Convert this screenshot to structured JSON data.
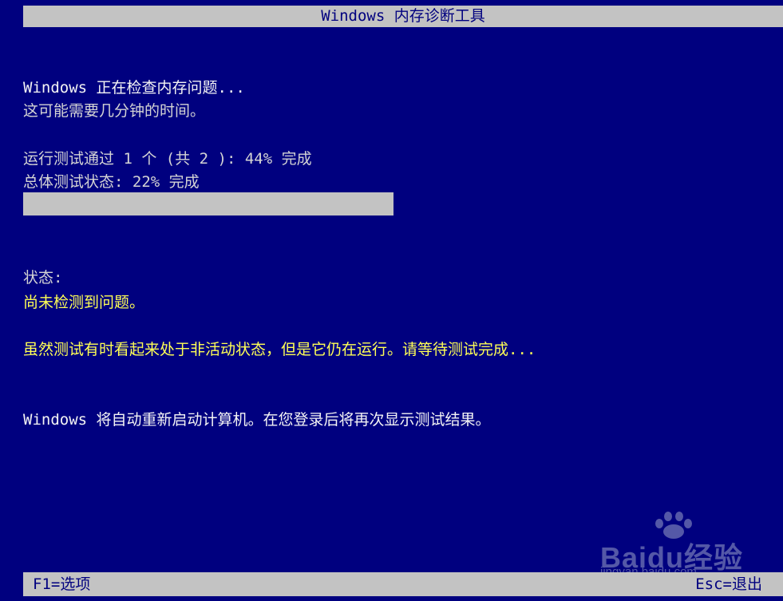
{
  "window": {
    "title": "Windows 内存诊断工具"
  },
  "main": {
    "checking_line": "Windows 正在检查内存问题...",
    "duration_note": "这可能需要几分钟的时间。",
    "pass_progress": "运行测试通过 1 个 (共 2 ): 44% 完成",
    "overall_progress": "总体测试状态: 22% 完成",
    "overall_percent": 22
  },
  "status": {
    "label": "状态:",
    "message": "尚未检测到问题。",
    "note": "虽然测试有时看起来处于非活动状态，但是它仍在运行。请等待测试完成..."
  },
  "restart_notice": "Windows 将自动重新启动计算机。在您登录后将再次显示测试结果。",
  "footer": {
    "options_label": "F1=选项",
    "exit_label": "Esc=退出"
  },
  "watermark": {
    "brand": "Baidu经验",
    "url": "jingyan.baidu.com"
  },
  "colors": {
    "background": "#00007f",
    "bar": "#c3c3c3",
    "status_text": "#ffff55"
  }
}
